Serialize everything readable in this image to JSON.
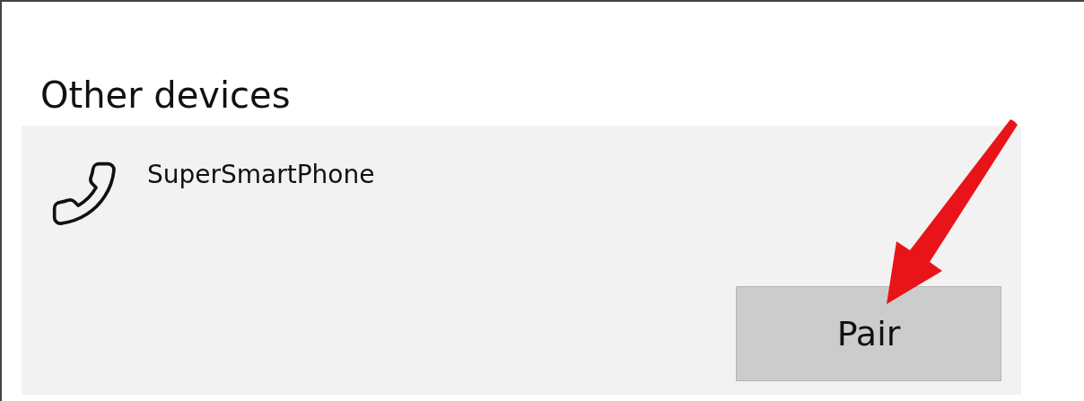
{
  "section": {
    "title": "Other devices"
  },
  "devices": [
    {
      "name": "SuperSmartPhone",
      "action": "Pair"
    }
  ]
}
